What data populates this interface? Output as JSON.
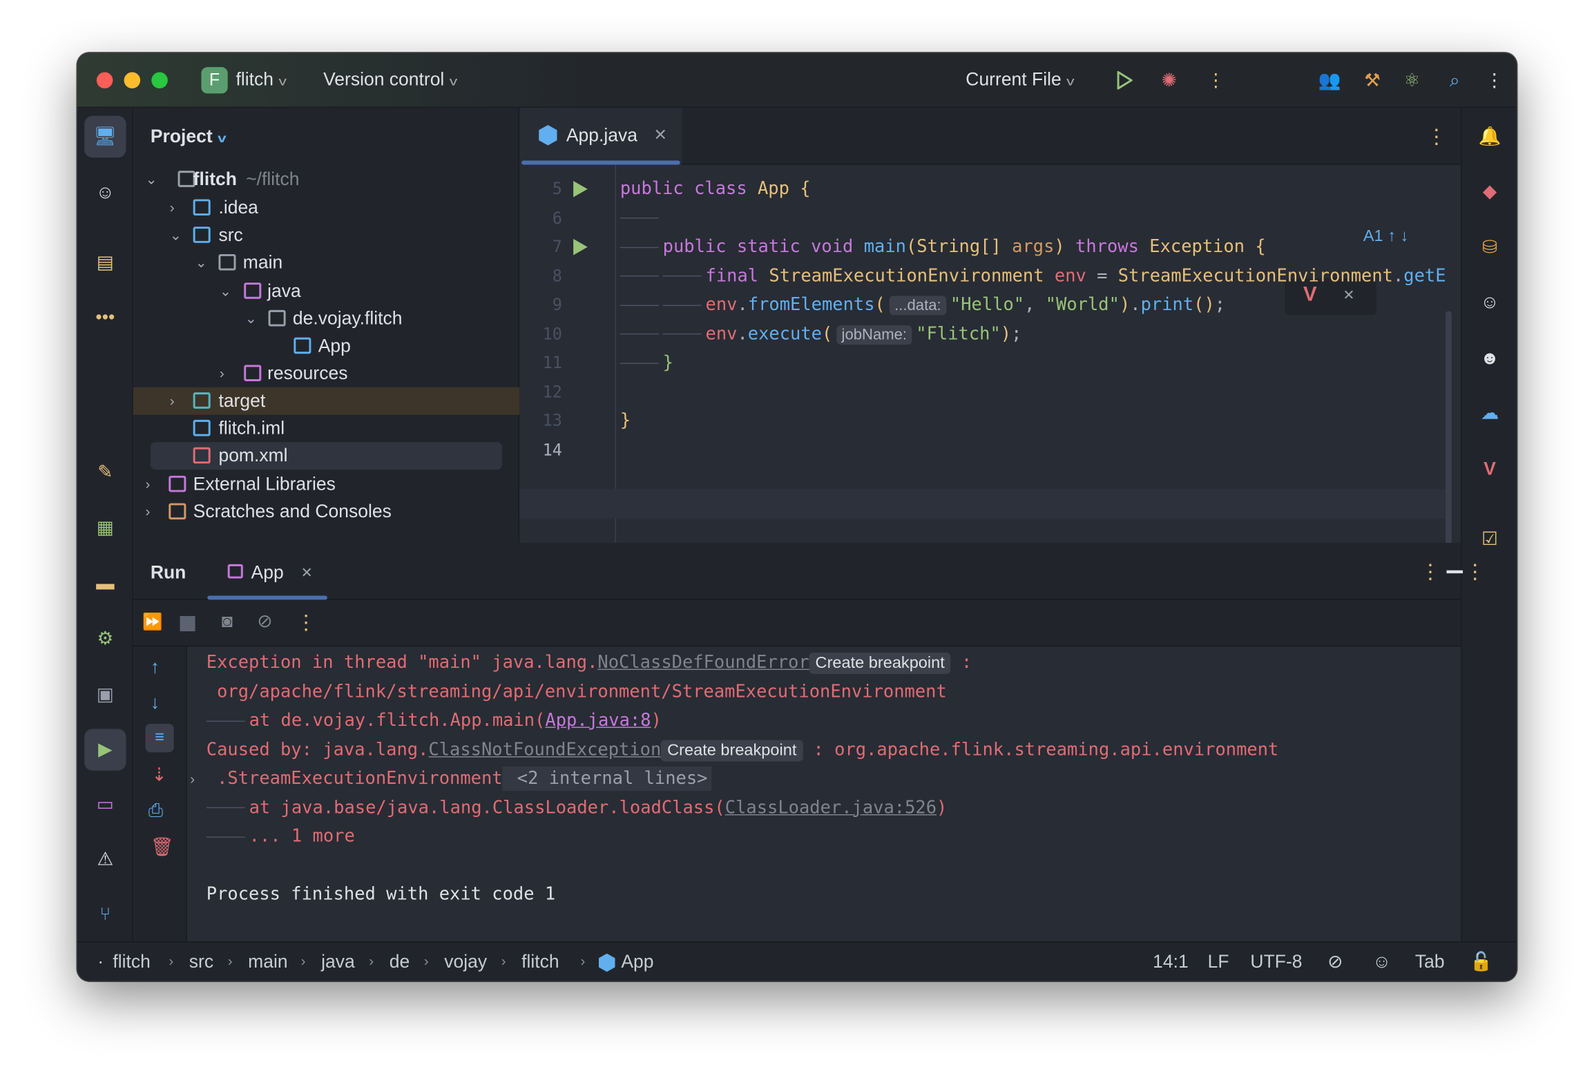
{
  "titlebar": {
    "project_initial": "F",
    "project_name": "flitch",
    "vcs": "Version control",
    "run_config": "Current File"
  },
  "project": {
    "title": "Project",
    "tree": [
      {
        "label": "flitch",
        "suffix": "~/flitch",
        "expanded": true
      },
      {
        "label": ".idea"
      },
      {
        "label": "src"
      },
      {
        "label": "main"
      },
      {
        "label": "java"
      },
      {
        "label": "de.vojay.flitch"
      },
      {
        "label": "App"
      },
      {
        "label": "resources"
      },
      {
        "label": "target"
      },
      {
        "label": "flitch.iml"
      },
      {
        "label": "pom.xml"
      },
      {
        "label": "External Libraries"
      },
      {
        "label": "Scratches and Consoles"
      }
    ]
  },
  "editor": {
    "tab": "App.java",
    "inspection_count": "1",
    "line_numbers": [
      "5",
      "6",
      "7",
      "8",
      "9",
      "10",
      "11",
      "12",
      "13",
      "14"
    ],
    "lines": [
      [
        [
          "public",
          "kw"
        ],
        [
          " ",
          "pl"
        ],
        [
          "class",
          "kw"
        ],
        [
          " ",
          "pl"
        ],
        [
          "App",
          "cls"
        ],
        [
          " ",
          "pl"
        ],
        [
          "{",
          "br"
        ]
      ],
      [],
      [
        [
          "public",
          "kw"
        ],
        [
          " ",
          "pl"
        ],
        [
          "static",
          "kw"
        ],
        [
          " ",
          "pl"
        ],
        [
          "void",
          "kw"
        ],
        [
          " ",
          "pl"
        ],
        [
          "main",
          "fn"
        ],
        [
          "(",
          "br"
        ],
        [
          "String",
          "cls"
        ],
        [
          "[]",
          "br"
        ],
        [
          " ",
          "pl"
        ],
        [
          "args",
          "param"
        ],
        [
          ")",
          "br"
        ],
        [
          " ",
          "pl"
        ],
        [
          "throws",
          "kw"
        ],
        [
          " ",
          "pl"
        ],
        [
          "Exception",
          "cls"
        ],
        [
          " ",
          "pl"
        ],
        [
          "{",
          "br"
        ]
      ],
      [
        [
          "final",
          "kw"
        ],
        [
          " ",
          "pl"
        ],
        [
          "StreamExecutionEnvironment",
          "cls"
        ],
        [
          " ",
          "pl"
        ],
        [
          "env",
          "var"
        ],
        [
          " = ",
          "pl"
        ],
        [
          "StreamExecutionEnvironment",
          "cls"
        ],
        [
          ".",
          "pl"
        ],
        [
          "getE",
          "fn"
        ]
      ],
      [
        [
          "env",
          "var"
        ],
        [
          ".",
          "pl"
        ],
        [
          "fromElements",
          "fn"
        ],
        [
          "(",
          "br"
        ],
        [
          "...data:",
          "hint"
        ],
        [
          "\"Hello\"",
          "str"
        ],
        [
          ", ",
          "pl"
        ],
        [
          "\"World\"",
          "str"
        ],
        [
          ")",
          "br"
        ],
        [
          ".",
          "pl"
        ],
        [
          "print",
          "fn"
        ],
        [
          "()",
          "br"
        ],
        [
          ";",
          "pl"
        ]
      ],
      [
        [
          "env",
          "var"
        ],
        [
          ".",
          "pl"
        ],
        [
          "execute",
          "fn"
        ],
        [
          "(",
          "br"
        ],
        [
          "jobName:",
          "hint"
        ],
        [
          "\"Flitch\"",
          "str"
        ],
        [
          ")",
          "br"
        ],
        [
          ";",
          "pl"
        ]
      ],
      [
        [
          "}",
          "grn"
        ]
      ],
      [],
      [
        [
          "}",
          "br"
        ]
      ],
      []
    ]
  },
  "run": {
    "title": "Run",
    "tab": "App",
    "console": {
      "l1a": "Exception in thread \"main\" java.lang.",
      "l1b": "NoClassDefFoundError",
      "l1c": "Create breakpoint",
      "l1d": " :",
      "l2": " org/apache/flink/streaming/api/environment/StreamExecutionEnvironment",
      "l3a": "at de.vojay.flitch.App.main(",
      "l3b": "App.java:8",
      "l3c": ")",
      "l4a": "Caused by: java.lang.",
      "l4b": "ClassNotFoundException",
      "l4c": "Create breakpoint",
      "l4d": " : org.apache.flink.streaming.api.environment",
      "l5a": " .StreamExecutionEnvironment",
      "l5b": " <2 internal lines>",
      "l6a": "at java.base/java.lang.ClassLoader.loadClass(",
      "l6b": "ClassLoader.java:526",
      "l6c": ")",
      "l7": "... 1 more",
      "l8": "Process finished with exit code 1"
    }
  },
  "status": {
    "breadcrumbs": [
      "flitch",
      "src",
      "main",
      "java",
      "de",
      "vojay",
      "flitch",
      "App"
    ],
    "position": "14:1",
    "line_sep": "LF",
    "encoding": "UTF-8",
    "indent": "Tab"
  },
  "colors": {
    "accent": "#4b6eaf",
    "error": "#e06c75",
    "keyword": "#c678dd",
    "run": "#98c379"
  }
}
